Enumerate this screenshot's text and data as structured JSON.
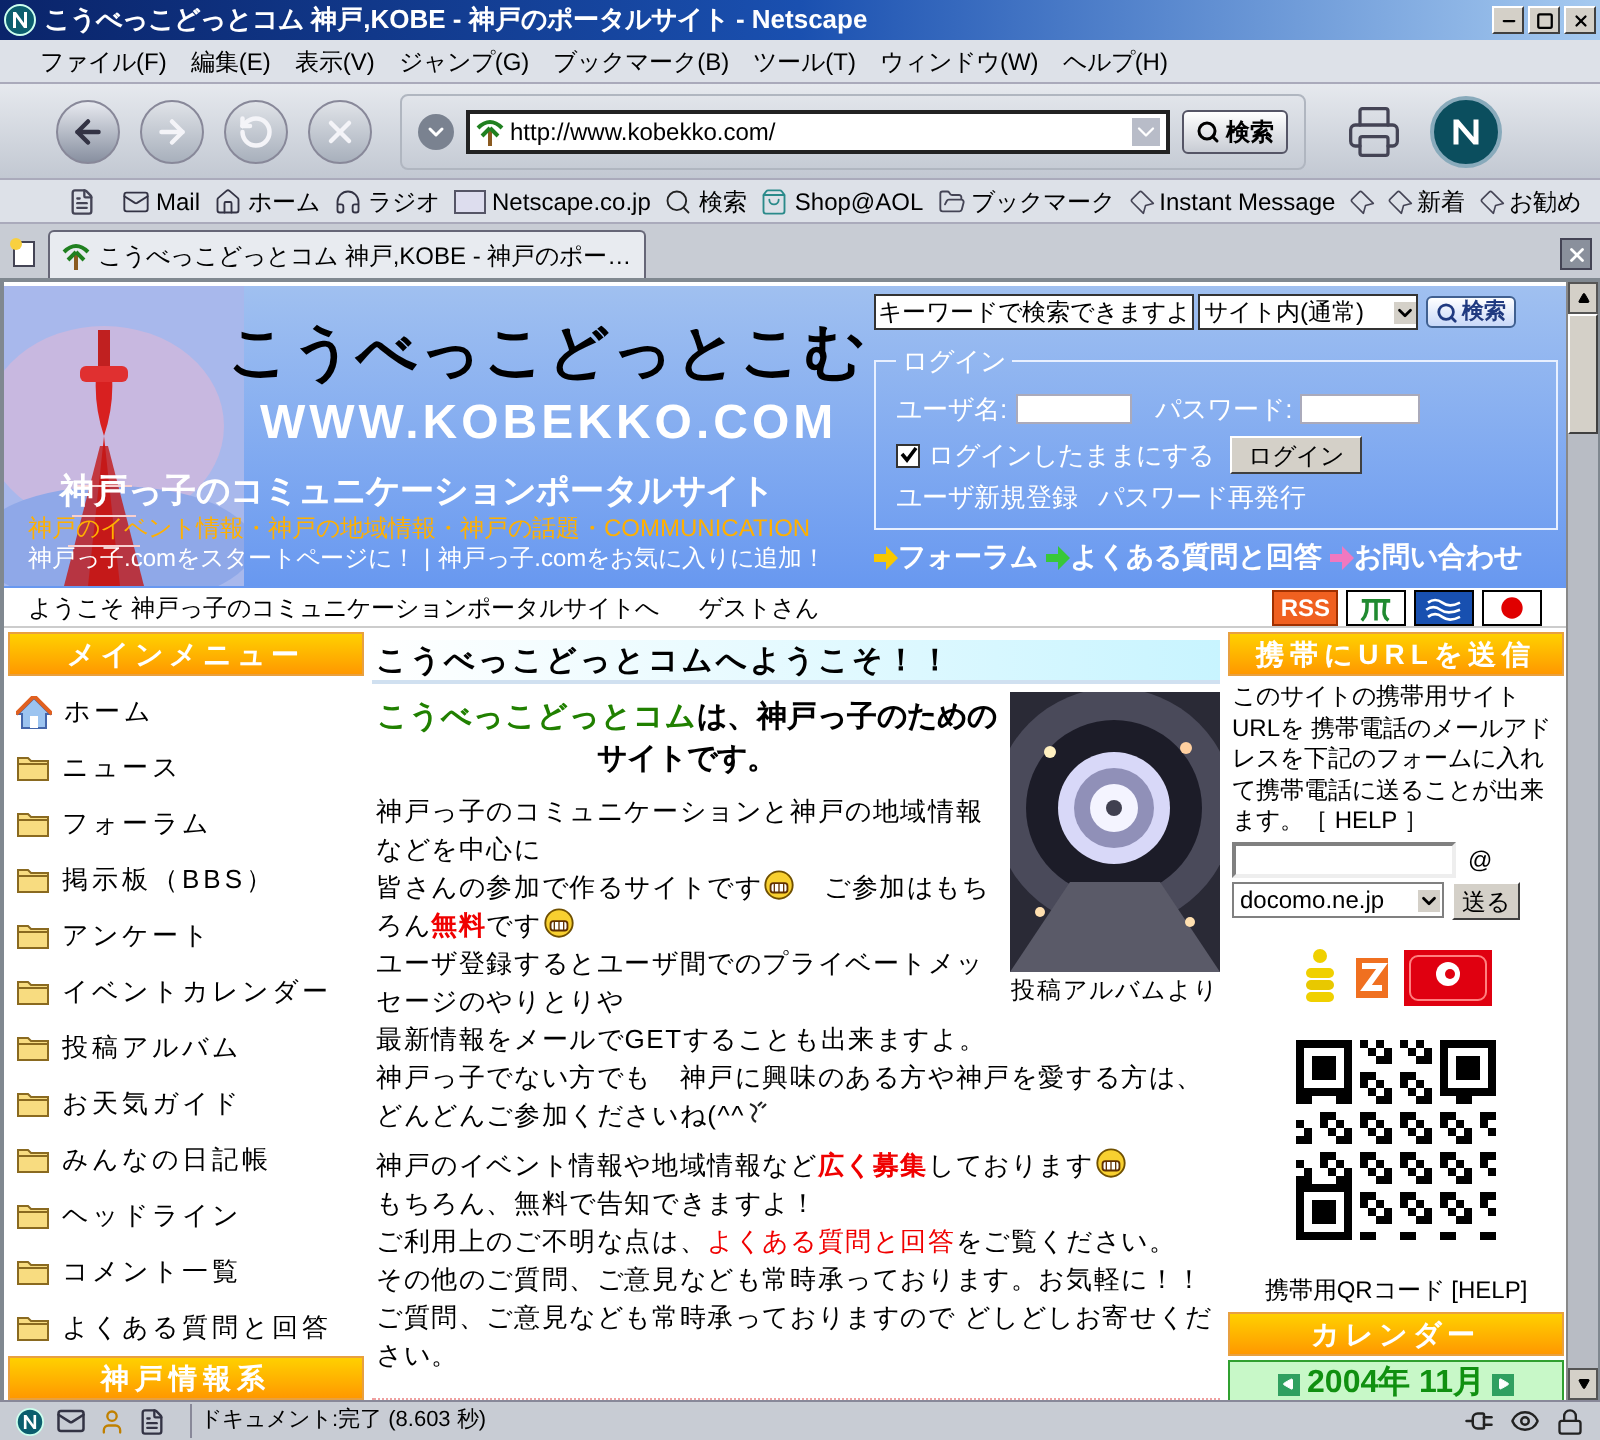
{
  "window": {
    "title": "こうべっこどっとコム 神戸,KOBE - 神戸のポータルサイト - Netscape"
  },
  "menu": [
    "ファイル(F)",
    "編集(E)",
    "表示(V)",
    "ジャンプ(G)",
    "ブックマーク(B)",
    "ツール(T)",
    "ウィンドウ(W)",
    "ヘルプ(H)"
  ],
  "navigation": {
    "url": "http://www.kobekko.com/",
    "search_button": "検索"
  },
  "personal_toolbar": [
    {
      "label": "Mail",
      "kind": "mail"
    },
    {
      "label": "ホーム",
      "kind": "home"
    },
    {
      "label": "ラジオ",
      "kind": "radio"
    },
    {
      "label": "Netscape.co.jp",
      "kind": "my"
    },
    {
      "label": "検索",
      "kind": "search"
    },
    {
      "label": "Shop@AOL",
      "kind": "shop"
    },
    {
      "label": "ブックマーク",
      "kind": "folder"
    },
    {
      "label": "Instant Message",
      "kind": "bookmark"
    },
    {
      "kind": "bookmark"
    },
    {
      "label": "新着",
      "kind": "bookmark"
    },
    {
      "label": "お勧め",
      "kind": "bookmark"
    }
  ],
  "tabs": [
    {
      "label": "こうべっこどっとコム 神戸,KOBE - 神戸のポー…",
      "selected": true
    }
  ],
  "page": {
    "site_search": {
      "value": "キーワードで検索できますよ",
      "scope": "サイト内(通常)",
      "button": "検索"
    },
    "banner": {
      "logo": "こうべっこどっとこむ",
      "domain": "WWW.KOBEKKO.COM",
      "tagline": "神戸っ子のコミュニケーションポータルサイト",
      "topics": "神戸のイベント情報・神戸の地域情報・神戸の話題・COMMUNICATION",
      "links": [
        "神戸っ子.comをスタートページに！",
        "神戸っ子.comをお気に入りに追加！"
      ],
      "separator": "|"
    },
    "login": {
      "legend": "ログイン",
      "username_label": "ユーザ名:",
      "password_label": "パスワード:",
      "remember": {
        "label": "ログインしたままにする",
        "checked": true
      },
      "button": "ログイン",
      "links": [
        "ユーザ新規登録",
        "パスワード再発行"
      ]
    },
    "quick_links": [
      {
        "label": "フォーラム",
        "color": "#f8c800"
      },
      {
        "label": "よくある質問と回答",
        "color": "#38c838"
      },
      {
        "label": "お問い合わせ",
        "color": "#f078c0"
      }
    ],
    "welcome": {
      "text": "ようこそ 神戸っ子のコミュニケーションポータルサイトへ",
      "user": "ゲストさん",
      "badges": [
        {
          "kind": "rss",
          "label": "RSS"
        },
        {
          "kind": "symbol"
        },
        {
          "kind": "wave"
        },
        {
          "kind": "flag"
        }
      ]
    },
    "main_menu": {
      "title": "メインメニュー",
      "items": [
        {
          "label": "ホーム",
          "kind": "home"
        },
        {
          "label": "ニュース",
          "kind": "folder"
        },
        {
          "label": "フォーラム",
          "kind": "folder"
        },
        {
          "label": "掲示板（BBS）",
          "kind": "folder"
        },
        {
          "label": "アンケート",
          "kind": "folder"
        },
        {
          "label": "イベントカレンダー",
          "kind": "folder"
        },
        {
          "label": "投稿アルバム",
          "kind": "folder"
        },
        {
          "label": "お天気ガイド",
          "kind": "folder"
        },
        {
          "label": "みんなの日記帳",
          "kind": "folder"
        },
        {
          "label": "ヘッドライン",
          "kind": "folder"
        },
        {
          "label": "コメント一覧",
          "kind": "folder"
        },
        {
          "label": "よくある質問と回答",
          "kind": "folder"
        }
      ]
    },
    "next_menu_title": "神戸情報系",
    "article": {
      "title": "こうべっこどっとコムへようこそ！！",
      "intro_name": "こうべっこどっとコム",
      "intro_rest": "は、神戸っ子のためのサイトです。",
      "photo_caption": "投稿アルバムより",
      "paragraphs": [
        [
          [
            {
              "kind": "text",
              "text": "神戸っ子のコミュニケーションと神戸の地域情報などを中心に"
            }
          ],
          [
            {
              "kind": "text",
              "text": "皆さんの参加で作るサイトです"
            },
            {
              "kind": "smiley"
            },
            {
              "kind": "text",
              "text": "　ご参加はもちろん"
            },
            {
              "kind": "strong",
              "text": "無料"
            },
            {
              "kind": "text",
              "text": "です"
            },
            {
              "kind": "smiley"
            }
          ],
          [
            {
              "kind": "text",
              "text": "ユーザ登録するとユーザ間でのプライベートメッセージのやりとりや"
            }
          ],
          [
            {
              "kind": "text",
              "text": "最新情報をメールでGETすることも出来ますよ。"
            }
          ],
          [
            {
              "kind": "text",
              "text": "神戸っ子でない方でも　神戸に興味のある方や神戸を愛する方は、どんどんご参加くださいね(^^"
            },
            {
              "kind": "scratch"
            }
          ]
        ],
        [
          [
            {
              "kind": "text",
              "text": "神戸のイベント情報や地域情報など"
            },
            {
              "kind": "strong",
              "text": "広く募集"
            },
            {
              "kind": "text",
              "text": "しております"
            },
            {
              "kind": "smiley"
            }
          ],
          [
            {
              "kind": "text",
              "text": "もちろん、無料で告知できますよ！"
            }
          ],
          [
            {
              "kind": "text",
              "text": "ご利用上のご不明な点は、"
            },
            {
              "kind": "link",
              "text": "よくある質問と回答"
            },
            {
              "kind": "text",
              "text": "をご覧ください。"
            }
          ],
          [
            {
              "kind": "text",
              "text": "その他のご質問、ご意見なども常時承っております。お気軽に！！"
            }
          ],
          [
            {
              "kind": "text",
              "text": "ご質問、ご意見なども常時承っておりますので どしどしお寄せください。"
            }
          ]
        ]
      ]
    },
    "mobile": {
      "title": "携帯にURLを送信",
      "description": "このサイトの携帯用サイトURLを 携帯電話のメールアドレスを下記のフォームに入れて携帯電話に送ることが出来ます。",
      "help": "［ HELP ］",
      "at": "@",
      "domain": "docomo.ne.jp",
      "button": "送る",
      "carriers": [
        {
          "kind": "imode"
        },
        {
          "kind": "ez"
        },
        {
          "kind": "vodafone"
        }
      ],
      "qr_caption": "携帯用QRコード [HELP]"
    },
    "calendar": {
      "title": "カレンダー",
      "month": "2004年 11月"
    }
  },
  "status_bar": {
    "text": "ドキュメント:完了 (8.603 秒)"
  }
}
